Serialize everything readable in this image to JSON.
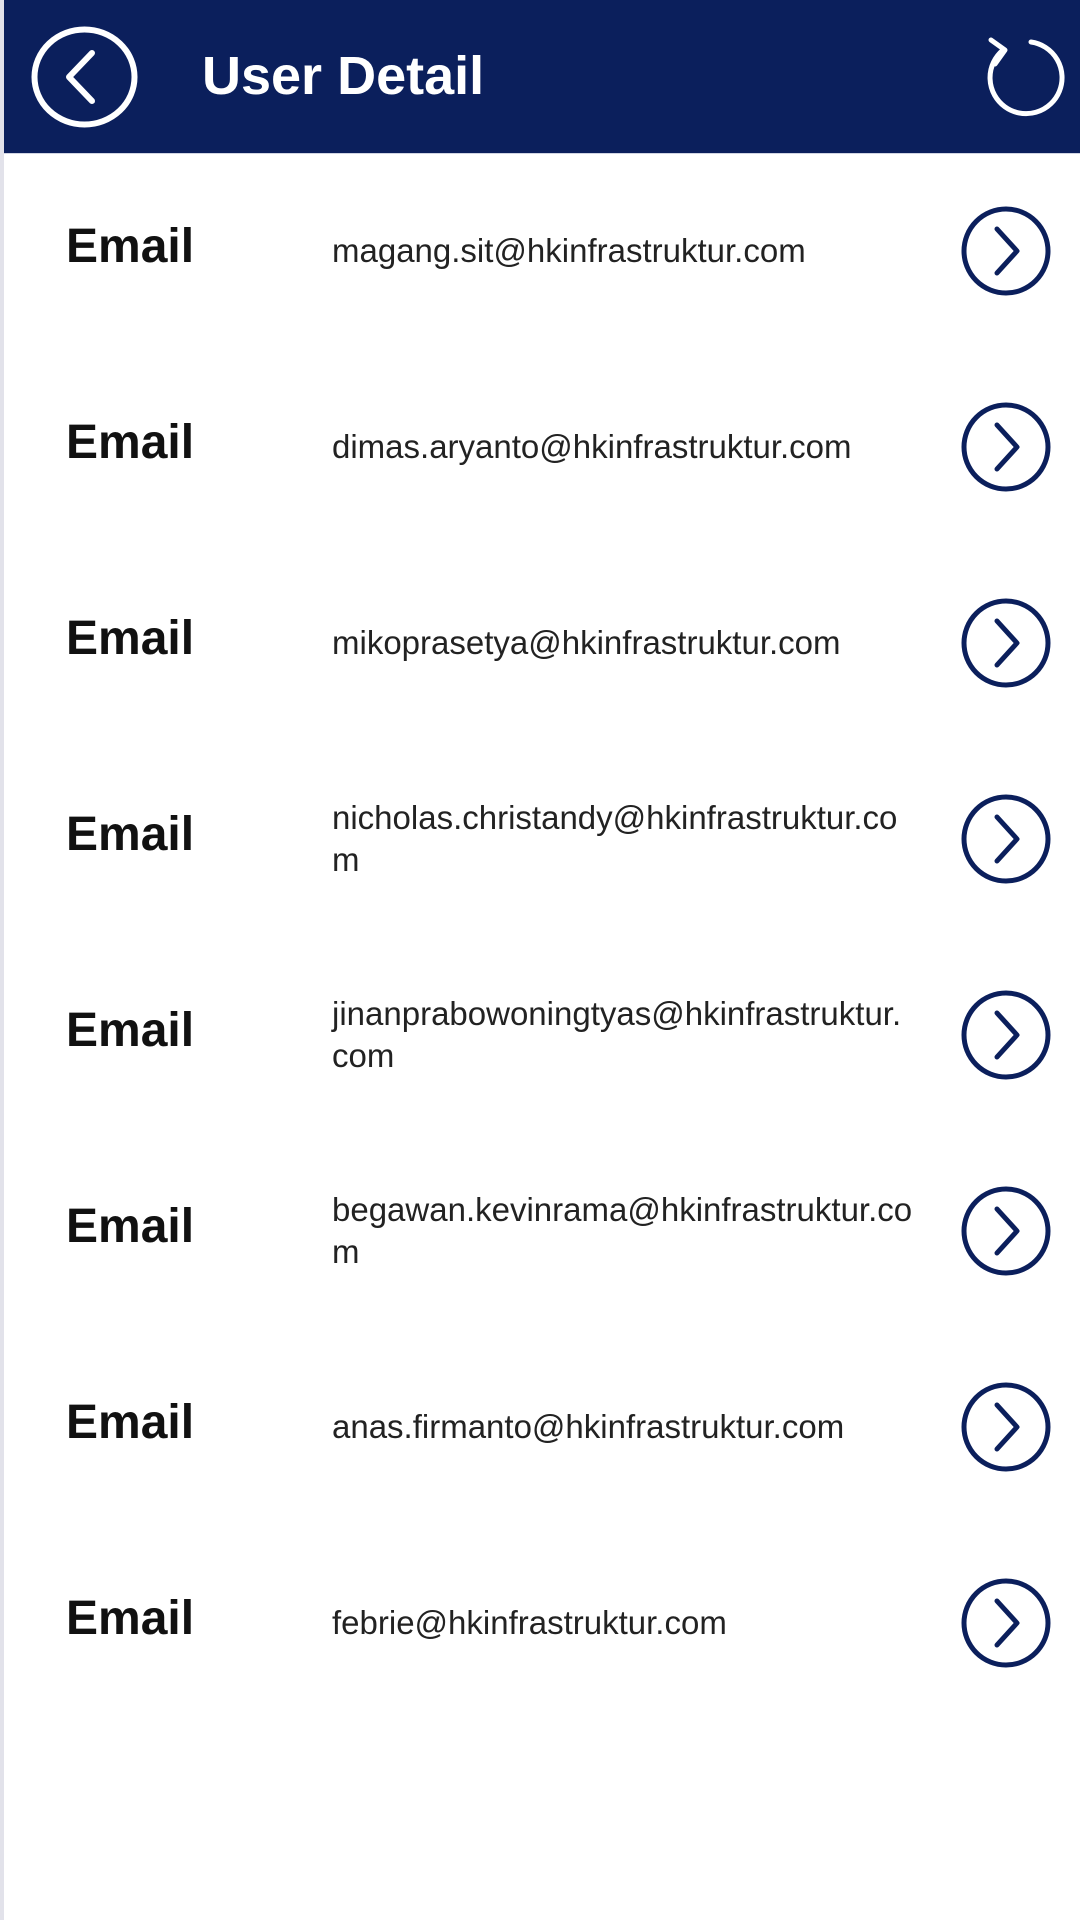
{
  "header": {
    "title": "User Detail",
    "back_icon": "chevron-left-circle-icon",
    "refresh_icon": "refresh-icon",
    "background": "#0b1f5c"
  },
  "list": {
    "label_text": "Email",
    "action_icon": "chevron-right-circle-icon",
    "accent": "#0b1f5c",
    "items": [
      {
        "label": "Email",
        "value": "magang.sit@hkinfrastruktur.com"
      },
      {
        "label": "Email",
        "value": "dimas.aryanto@hkinfrastruktur.com"
      },
      {
        "label": "Email",
        "value": "mikoprasetya@hkinfrastruktur.com"
      },
      {
        "label": "Email",
        "value": "nicholas.christandy@hkinfrastruktur.com"
      },
      {
        "label": "Email",
        "value": "jinanprabowoningtyas@hkinfrastruktur.com"
      },
      {
        "label": "Email",
        "value": "begawan.kevinrama@hkinfrastruktur.com"
      },
      {
        "label": "Email",
        "value": "anas.firmanto@hkinfrastruktur.com"
      },
      {
        "label": "Email",
        "value": "febrie@hkinfrastruktur.com"
      }
    ]
  }
}
